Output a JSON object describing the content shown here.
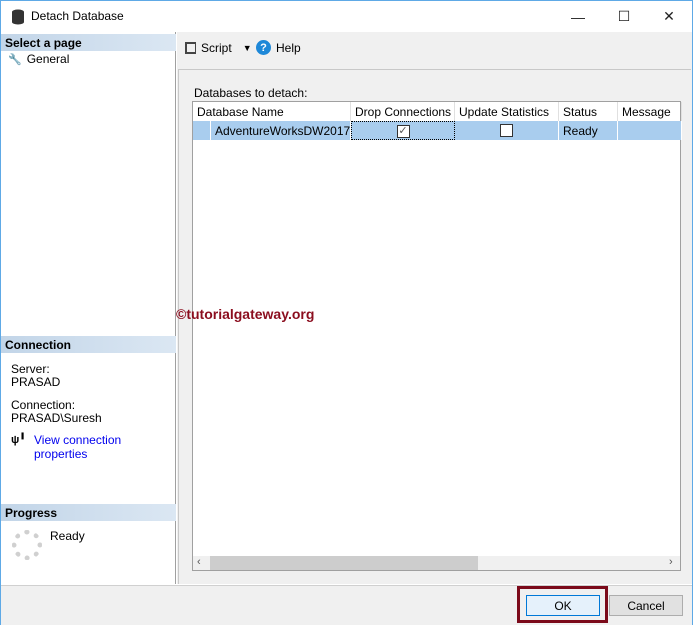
{
  "window": {
    "title": "Detach Database",
    "min": "—",
    "max": "☐",
    "close": "✕"
  },
  "left": {
    "select_page": "Select a page",
    "pages": [
      {
        "label": "General"
      }
    ],
    "connection_header": "Connection",
    "server_label": "Server:",
    "server": "PRASAD",
    "connection_label": "Connection:",
    "connection": "PRASAD\\Suresh",
    "view_link": "View connection properties",
    "progress_header": "Progress",
    "progress_status": "Ready"
  },
  "toolbar": {
    "script": "Script",
    "help": "Help"
  },
  "main": {
    "label": "Databases to detach:",
    "columns": [
      "Database Name",
      "Drop Connections",
      "Update Statistics",
      "Status",
      "Message"
    ],
    "rows": [
      {
        "name": "AdventureWorksDW2017",
        "drop_connections": true,
        "update_statistics": false,
        "status": "Ready",
        "message": ""
      }
    ]
  },
  "watermark": "©tutorialgateway.org",
  "buttons": {
    "ok": "OK",
    "cancel": "Cancel"
  }
}
